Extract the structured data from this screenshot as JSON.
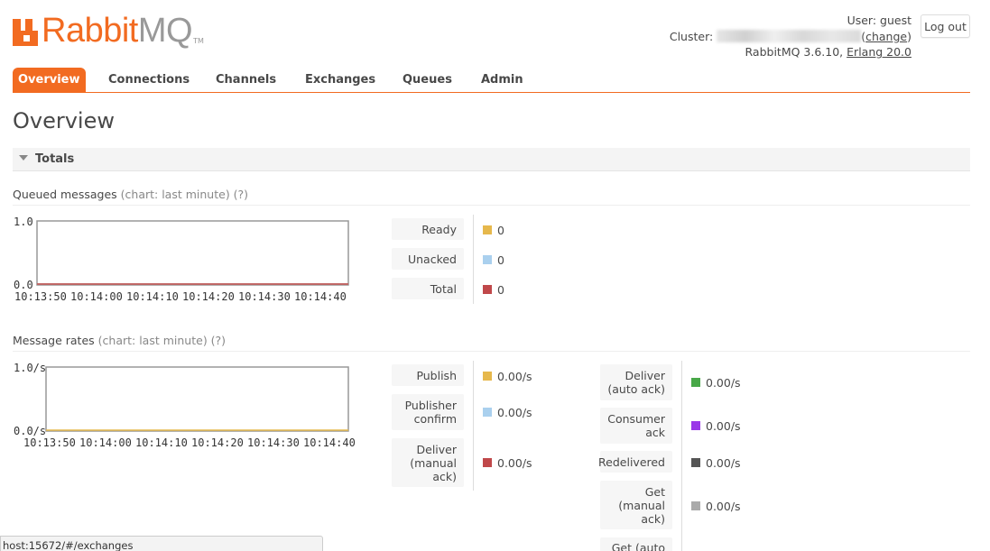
{
  "header": {
    "logo_rabbit": "Rabbit",
    "logo_mq": "MQ",
    "logo_tm": "TM",
    "user_label": "User:",
    "user_name": "guest",
    "cluster_label": "Cluster:",
    "change_link": "change",
    "version_text": "RabbitMQ 3.6.10,",
    "erlang_link": "Erlang 20.0",
    "logout_label": "Log out"
  },
  "tabs": [
    "Overview",
    "Connections",
    "Channels",
    "Exchanges",
    "Queues",
    "Admin"
  ],
  "active_tab": "Overview",
  "page_title": "Overview",
  "section": {
    "title": "Totals"
  },
  "queued": {
    "title": "Queued messages",
    "chart_note": "(chart: last minute) (?)",
    "rows": [
      {
        "label": "Ready",
        "value": "0",
        "color": "#e6b84c"
      },
      {
        "label": "Unacked",
        "value": "0",
        "color": "#aad0ee"
      },
      {
        "label": "Total",
        "value": "0",
        "color": "#c0484a"
      }
    ]
  },
  "rates": {
    "title": "Message rates",
    "chart_note": "(chart: last minute) (?)",
    "col1": [
      {
        "label": "Publish",
        "value": "0.00/s",
        "color": "#e6b84c"
      },
      {
        "label": "Publisher confirm",
        "value": "0.00/s",
        "color": "#aad0ee"
      },
      {
        "label": "Deliver (manual ack)",
        "value": "0.00/s",
        "color": "#c0484a"
      }
    ],
    "col2": [
      {
        "label": "Deliver (auto ack)",
        "value": "0.00/s",
        "color": "#48a848"
      },
      {
        "label": "Consumer ack",
        "value": "0.00/s",
        "color": "#9a38e8"
      },
      {
        "label": "Redelivered",
        "value": "0.00/s",
        "color": "#555555"
      },
      {
        "label": "Get (manual ack)",
        "value": "0.00/s",
        "color": "#aaaaaa"
      },
      {
        "label": "Get (auto",
        "value": "",
        "color": ""
      }
    ]
  },
  "chart_data": [
    {
      "type": "line",
      "name": "Queued messages",
      "x": [
        "10:13:50",
        "10:14:00",
        "10:14:10",
        "10:14:20",
        "10:14:30",
        "10:14:40"
      ],
      "ylim": [
        0.0,
        1.0
      ],
      "ytick_labels": [
        "0.0",
        "1.0"
      ],
      "series": [
        {
          "name": "Ready",
          "values": [
            0,
            0,
            0,
            0,
            0,
            0
          ],
          "color": "#e6b84c"
        },
        {
          "name": "Unacked",
          "values": [
            0,
            0,
            0,
            0,
            0,
            0
          ],
          "color": "#aad0ee"
        },
        {
          "name": "Total",
          "values": [
            0,
            0,
            0,
            0,
            0,
            0
          ],
          "color": "#c0484a"
        }
      ]
    },
    {
      "type": "line",
      "name": "Message rates",
      "x": [
        "10:13:50",
        "10:14:00",
        "10:14:10",
        "10:14:20",
        "10:14:30",
        "10:14:40"
      ],
      "ylim": [
        0.0,
        1.0
      ],
      "ytick_labels": [
        "0.0/s",
        "1.0/s"
      ],
      "series": [
        {
          "name": "Publish",
          "values": [
            0,
            0,
            0,
            0,
            0,
            0
          ],
          "color": "#e6b84c"
        }
      ]
    }
  ],
  "status_bar": "host:15672/#/exchanges"
}
